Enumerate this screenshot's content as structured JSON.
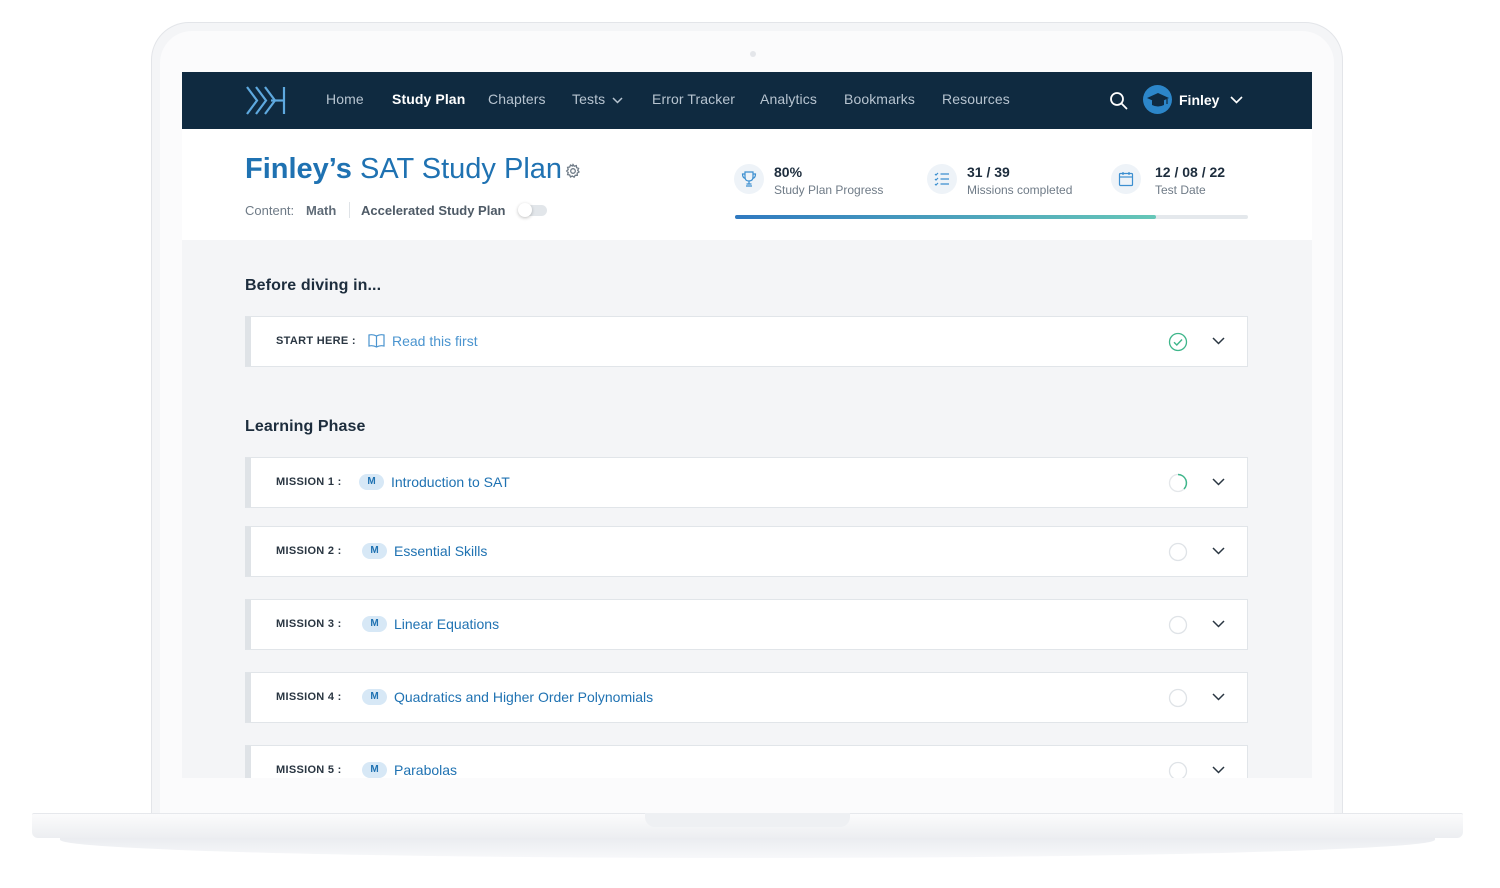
{
  "nav": {
    "items": [
      "Home",
      "Study Plan",
      "Chapters",
      "Tests",
      "Error Tracker",
      "Analytics",
      "Bookmarks",
      "Resources"
    ],
    "active": "Study Plan",
    "user_name": "Finley"
  },
  "header": {
    "title_bold": "Finley’s",
    "title_rest": "SAT Study Plan",
    "content_label": "Content:",
    "content_value": "Math",
    "accelerated_label": "Accelerated Study Plan",
    "accelerated_enabled": false,
    "stats": {
      "progress_value": "80%",
      "progress_label": "Study Plan Progress",
      "missions_value": "31 / 39",
      "missions_label": "Missions completed",
      "test_date_value": "12 / 08 / 22",
      "test_date_label": "Test Date"
    },
    "progress_fraction": 0.82
  },
  "sections": {
    "before": {
      "title": "Before diving in...",
      "card_label": "START HERE :",
      "card_link": "Read this first",
      "status": "complete"
    },
    "learning": {
      "title": "Learning Phase",
      "missions": [
        {
          "label": "MISSION 1 :",
          "badge": "M",
          "title": "Introduction to SAT",
          "status": "in-progress"
        },
        {
          "label": "MISSION 2 :",
          "badge": "M",
          "title": "Essential Skills",
          "status": "not-started"
        },
        {
          "label": "MISSION 3 :",
          "badge": "M",
          "title": "Linear Equations",
          "status": "not-started"
        },
        {
          "label": "MISSION 4 :",
          "badge": "M",
          "title": "Quadratics and Higher Order Polynomials",
          "status": "not-started"
        },
        {
          "label": "MISSION 5 :",
          "badge": "M",
          "title": "Parabolas",
          "status": "not-started"
        }
      ]
    }
  },
  "colors": {
    "navbar": "#0f2a40",
    "accent": "#1f72b2",
    "complete": "#3fb68b"
  }
}
